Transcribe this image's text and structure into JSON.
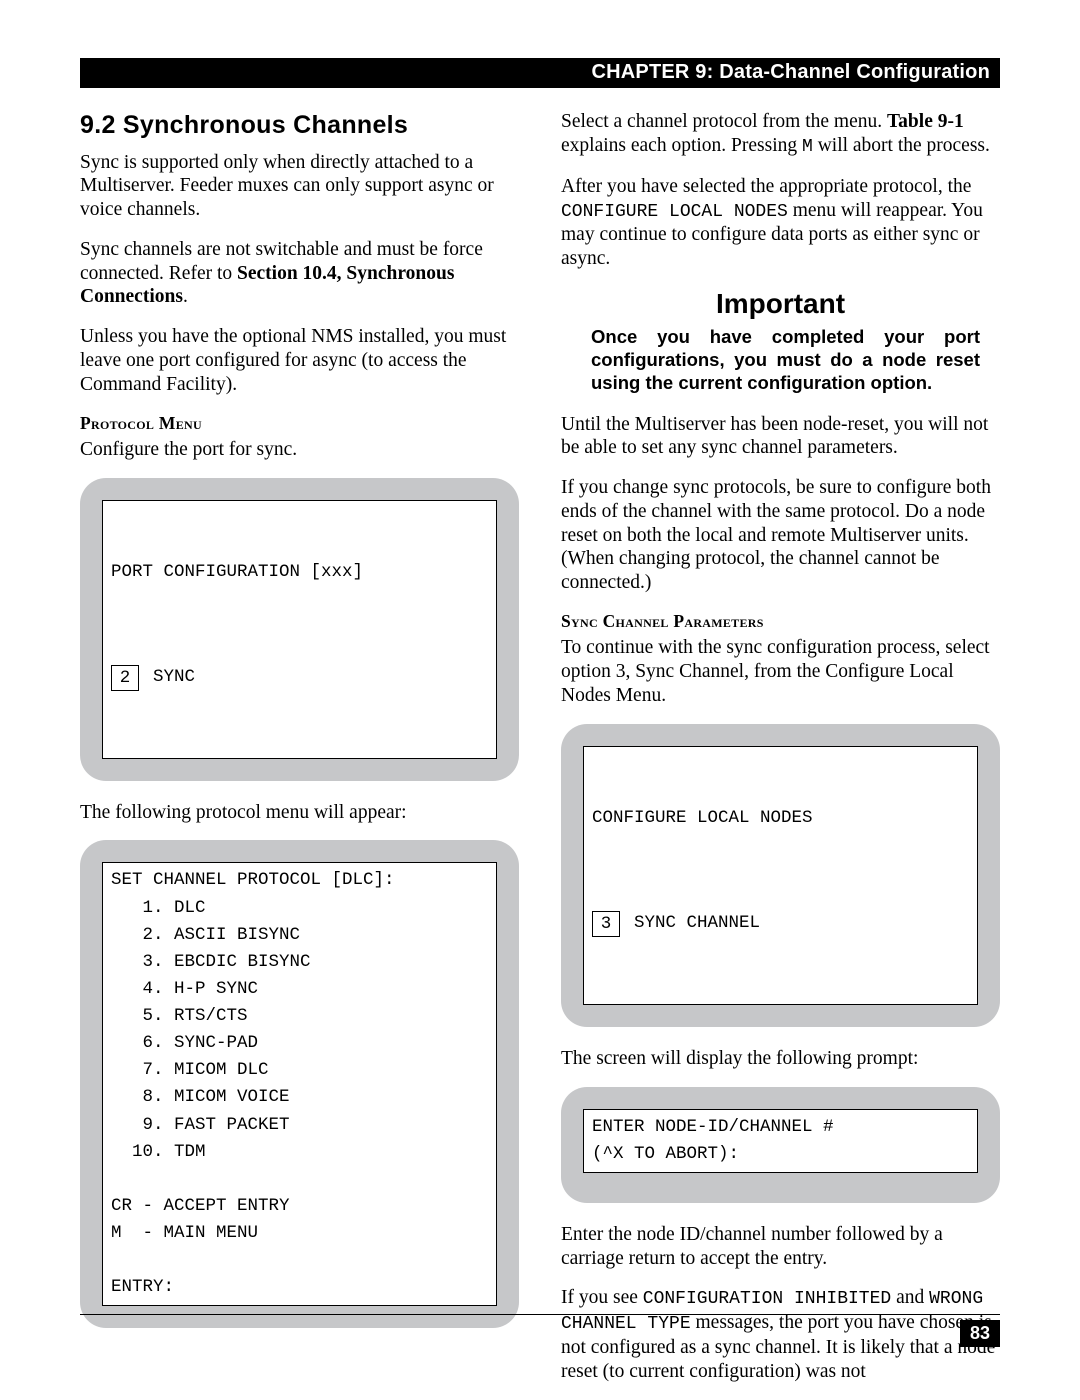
{
  "header": "CHAPTER 9: Data-Channel Configuration",
  "page_number": "83",
  "left": {
    "heading": "9.2  Synchronous Channels",
    "p1": "Sync is supported only when directly attached to a Multiserver. Feeder muxes can only support async or voice channels.",
    "p2a": "Sync channels are not switchable and must be force connected. Refer to ",
    "p2b": "Section 10.4, Synchronous Connections",
    "p2c": ".",
    "p3": "Unless you have the optional NMS installed, you must leave one port configured for async (to access the Command Facility).",
    "h_protocol": "Protocol Menu",
    "p4": "Configure the port for sync.",
    "screen1_title": "PORT CONFIGURATION [xxx]",
    "screen1_opt_num": "2",
    "screen1_opt_label": "SYNC",
    "p5": "The following protocol menu will appear:",
    "screen2": "SET CHANNEL PROTOCOL [DLC]:\n   1. DLC\n   2. ASCII BISYNC\n   3. EBCDIC BISYNC\n   4. H-P SYNC\n   5. RTS/CTS\n   6. SYNC-PAD\n   7. MICOM DLC\n   8. MICOM VOICE\n   9. FAST PACKET\n  10. TDM\n\nCR - ACCEPT ENTRY\nM  - MAIN MENU\n\nENTRY:"
  },
  "right": {
    "p1a": "Select a channel protocol from the menu. ",
    "p1b": "Table 9-1",
    "p1c": " explains each option. Pressing ",
    "p1_mono": "M",
    "p1d": " will abort the process.",
    "p2a": "After you have selected the appropriate protocol, the ",
    "p2_mono": "CONFIGURE LOCAL NODES",
    "p2b": " menu will reappear. You may continue to configure data ports as either sync or async.",
    "important_head": "Important",
    "important_body": "Once you have completed your port configurations, you must do a node reset using the current configuration option.",
    "p3": "Until the Multiserver has been node-reset, you will not be able to set any sync channel parameters.",
    "p4": "If you change sync protocols, be sure to configure both ends of the channel with the same protocol. Do a node reset on both the local and remote Multiserver units. (When changing protocol, the channel cannot be connected.)",
    "h_sync": "Sync Channel Parameters",
    "p5": "To continue with the sync configuration process, select option 3, Sync Channel, from the Configure Local Nodes Menu.",
    "screen3_title": "CONFIGURE LOCAL NODES",
    "screen3_opt_num": "3",
    "screen3_opt_label": "SYNC CHANNEL",
    "p6": "The screen will display the following prompt:",
    "screen4": "ENTER NODE-ID/CHANNEL #\n(^X TO ABORT):",
    "p7": "Enter the node ID/channel number followed by a carriage return to accept the entry.",
    "p8a": "If you see ",
    "p8_mono1": "CONFIGURATION INHIBITED",
    "p8b": " and ",
    "p8_mono2": "WRONG CHANNEL TYPE",
    "p8c": " messages, the port you have chosen is not configured as a sync channel. It is likely that a node reset (to current configuration) was not"
  }
}
